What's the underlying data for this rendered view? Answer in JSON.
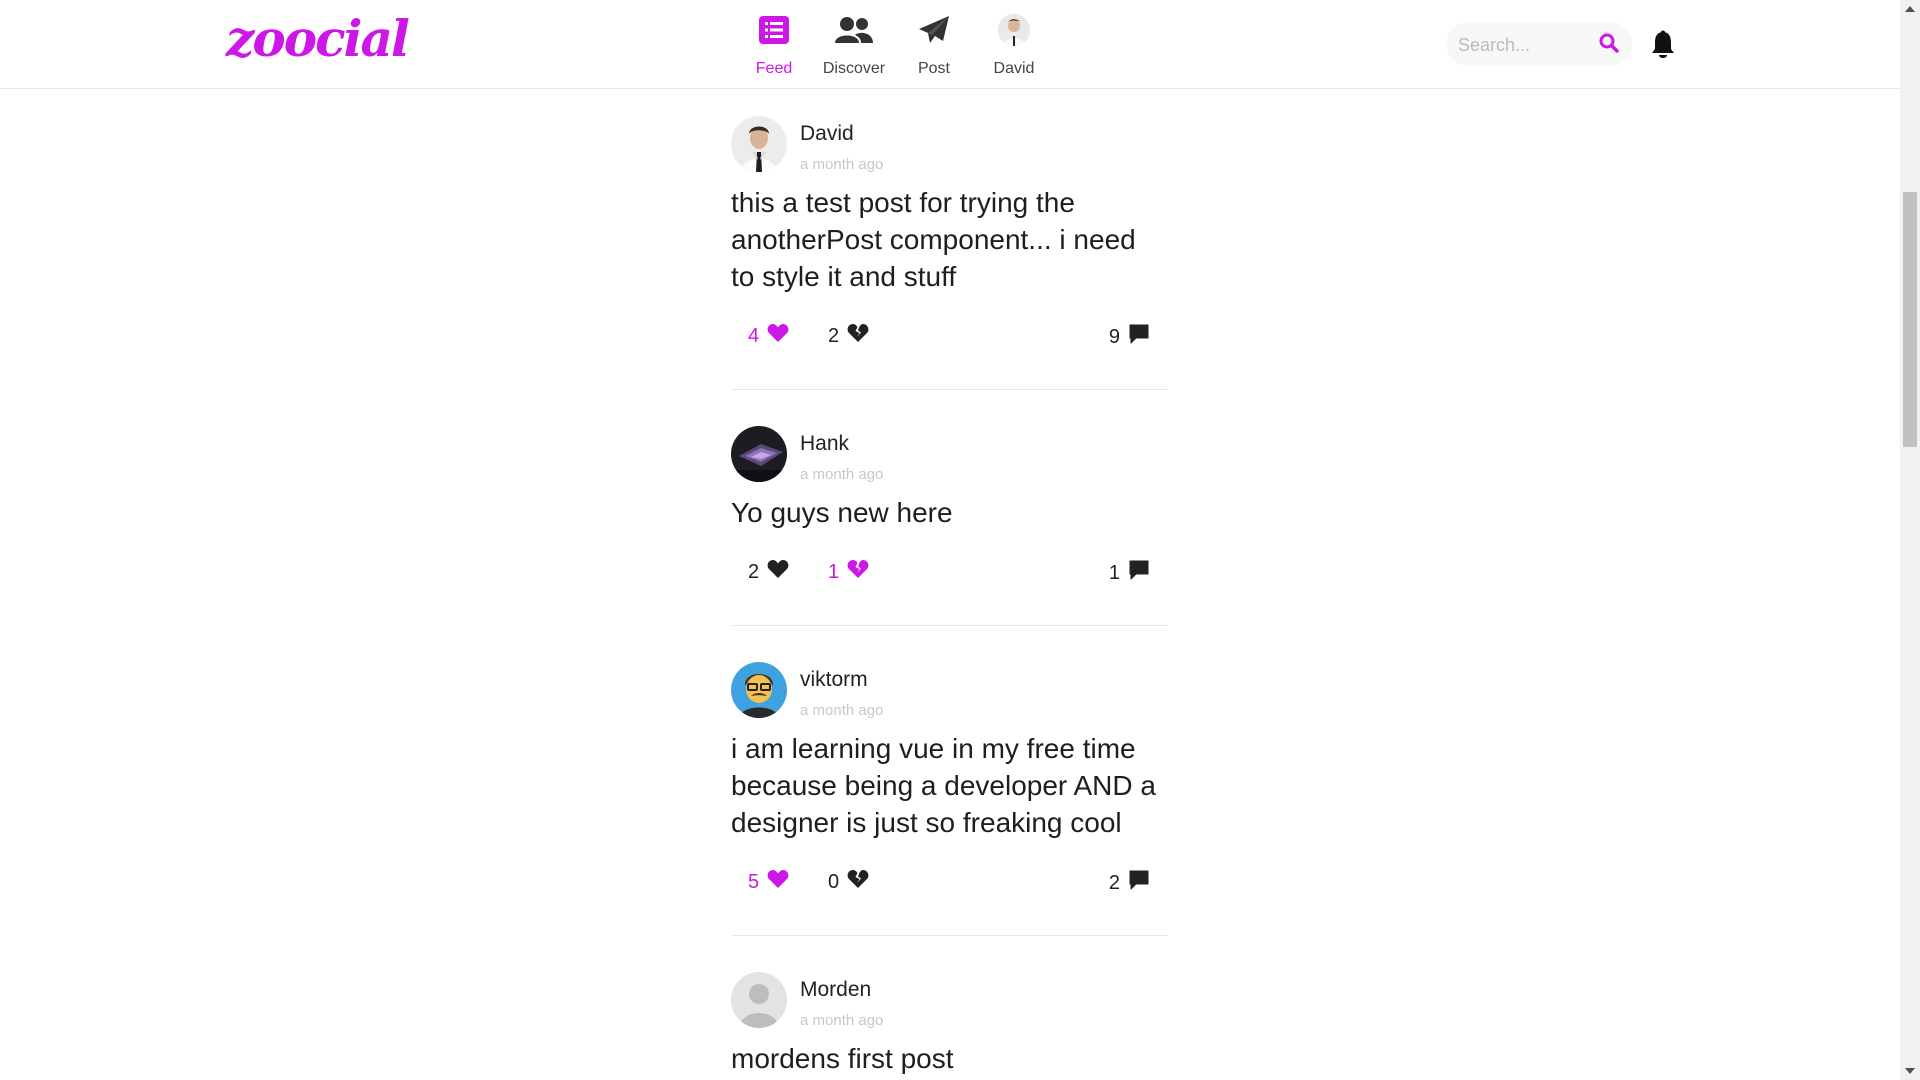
{
  "app": {
    "logo": "zoocial"
  },
  "nav": {
    "items": [
      {
        "label": "Feed",
        "icon": "list-icon"
      },
      {
        "label": "Discover",
        "icon": "users-icon"
      },
      {
        "label": "Post",
        "icon": "paper-plane-icon"
      },
      {
        "label": "David",
        "icon": "avatar"
      }
    ],
    "active": "Feed"
  },
  "search": {
    "placeholder": "Search..."
  },
  "colors": {
    "accent": "#cc17e6",
    "text": "#222222",
    "muted": "#c8c8c8"
  },
  "posts": [
    {
      "author": "David",
      "time": "a month ago",
      "body": "this a test post for trying the anotherPost component... i need to style it and stuff",
      "likes": "4",
      "dislikes": "2",
      "comments": "9",
      "liked": true,
      "disliked": false
    },
    {
      "author": "Hank",
      "time": "a month ago",
      "body": "Yo guys new here",
      "likes": "2",
      "dislikes": "1",
      "comments": "1",
      "liked": false,
      "disliked": true
    },
    {
      "author": "viktorm",
      "time": "a month ago",
      "body": "i am learning vue in my free time because being a developer AND a designer is just so freaking cool",
      "likes": "5",
      "dislikes": "0",
      "comments": "2",
      "liked": true,
      "disliked": false
    },
    {
      "author": "Morden",
      "time": "a month ago",
      "body": "mordens first post"
    }
  ]
}
